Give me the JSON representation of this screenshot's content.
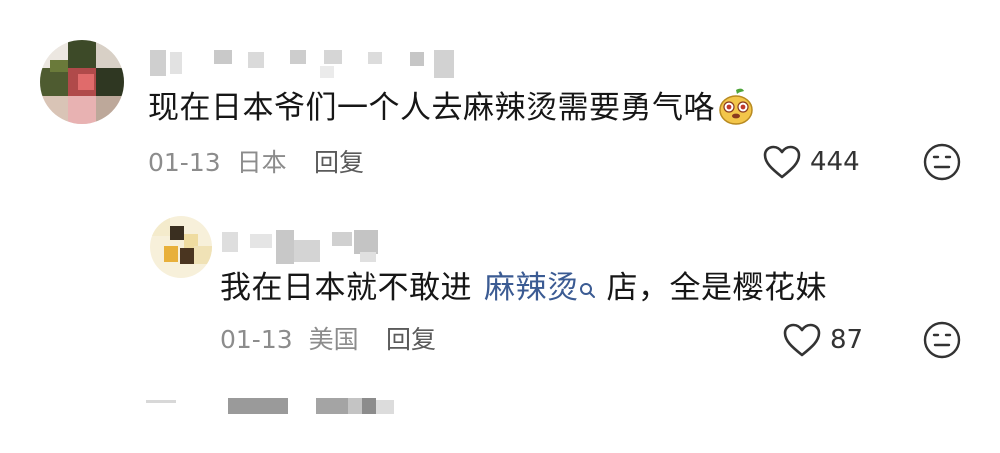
{
  "comments": [
    {
      "text": "现在日本爷们一个人去麻辣烫需要勇气咯",
      "emoji": "pear-face-emoji",
      "date": "01-13",
      "location": "日本",
      "reply_label": "回复",
      "likes": "444"
    }
  ],
  "reply": {
    "text_before": "我在日本就不敢进",
    "link_text": "麻辣烫",
    "text_after": "店，全是樱花妹",
    "date": "01-13",
    "location": "美国",
    "reply_label": "回复",
    "likes": "87"
  },
  "icons": {
    "like": "heart-outline-icon",
    "dislike": "neutral-face-icon",
    "search": "search-icon"
  },
  "colors": {
    "link": "#3b5b93",
    "meta": "#8c8c8c"
  }
}
